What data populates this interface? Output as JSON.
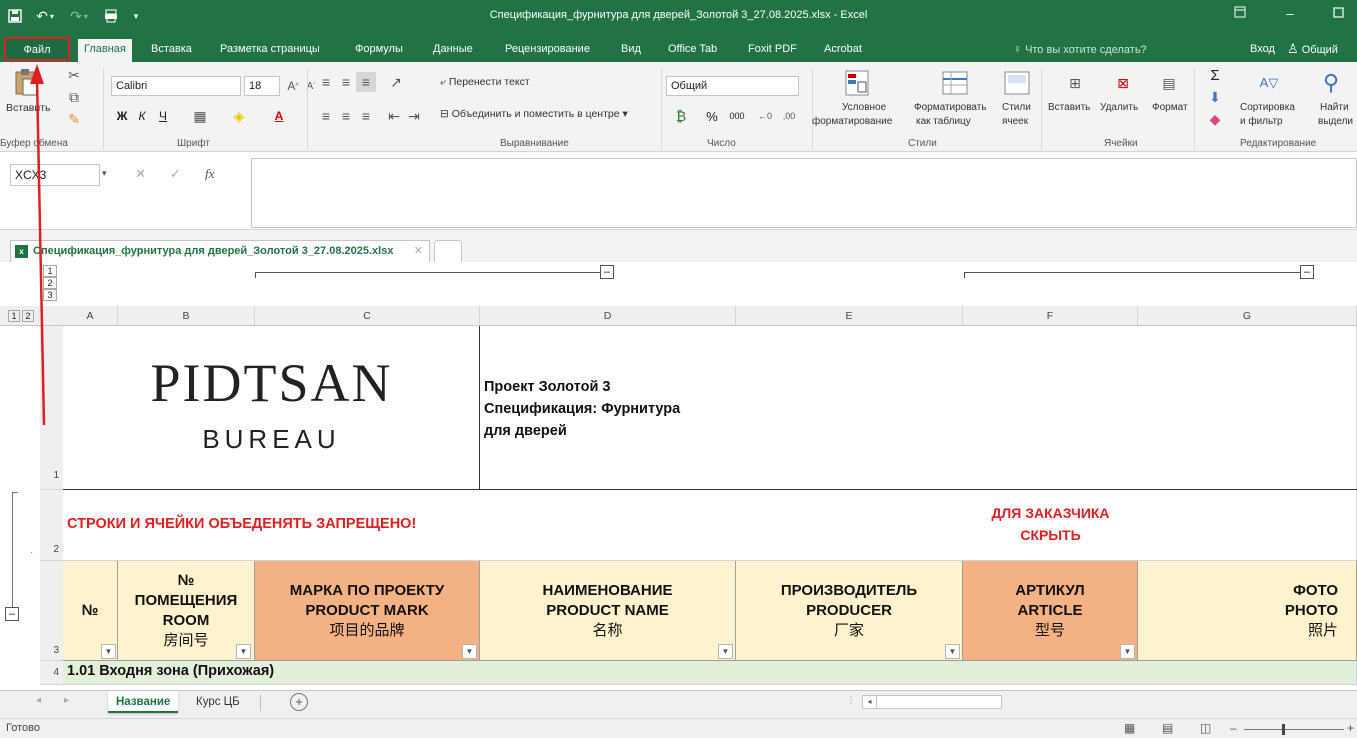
{
  "window": {
    "title": "Спецификация_фурнитура для дверей_Золотой 3_27.08.2025.xlsx  -  Excel"
  },
  "ribbon_tabs": {
    "file": "Файл",
    "items": [
      "Главная",
      "Вставка",
      "Разметка страницы",
      "Формулы",
      "Данные",
      "Рецензирование",
      "Вид",
      "Office Tab",
      "Foxit PDF",
      "Acrobat"
    ],
    "tell_me": "Что вы хотите сделать?",
    "sign_in": "Вход",
    "share": "Общий"
  },
  "ribbon": {
    "clipboard": {
      "paste": "Вставить",
      "group": "Буфер обмена"
    },
    "font": {
      "name": "Calibri",
      "size": "18",
      "group": "Шрифт"
    },
    "alignment": {
      "wrap": "Перенести текст",
      "merge": "Объединить и поместить в центре",
      "group": "Выравнивание"
    },
    "number": {
      "format": "Общий",
      "group": "Число"
    },
    "styles": {
      "cond1": "Условное",
      "cond2": "форматирование",
      "table1": "Форматировать",
      "table2": "как таблицу",
      "cell1": "Стили",
      "cell2": "ячеек",
      "group": "Стили"
    },
    "cells": {
      "insert": "Вставить",
      "delete": "Удалить",
      "format": "Формат",
      "group": "Ячейки"
    },
    "editing": {
      "sort1": "Сортировка",
      "sort2": "и фильтр",
      "find1": "Найти",
      "find2": "выдели",
      "group": "Редактирование"
    }
  },
  "formula_bar": {
    "name_box": "XCX3",
    "fx": "fx",
    "content": ""
  },
  "workbook_tab": {
    "name": "Спецификация_фурнитура для дверей_Золотой 3_27.08.2025.xlsx"
  },
  "grid": {
    "outline_levels_rows": [
      "1",
      "2",
      "3"
    ],
    "outline_levels_cols": [
      "1",
      "2"
    ],
    "column_headers": [
      "A",
      "B",
      "C",
      "D",
      "E",
      "F",
      "G"
    ],
    "row_headers": [
      "1",
      "2",
      "3",
      "4"
    ],
    "logo": {
      "main": "PIDTSAN",
      "sub": "BUREAU"
    },
    "project_lines": [
      "Проект Золотой 3",
      "Спецификация: Фурнитура",
      "для дверей"
    ],
    "warning": "СТРОКИ И ЯЧЕЙКИ ОБЪЕДЕНЯТЬ ЗАПРЕЩЕНО!",
    "customer_note": [
      "ДЛЯ ЗАКАЗЧИКА",
      "СКРЫТЬ"
    ],
    "headers": [
      {
        "lines": [
          "№"
        ],
        "cn": ""
      },
      {
        "lines": [
          "№",
          "ПОМЕЩЕНИЯ",
          "ROOM"
        ],
        "cn": "房间号"
      },
      {
        "lines": [
          "МАРКА ПО ПРОЕКТУ",
          "PRODUCT MARK"
        ],
        "cn": "项目的品牌"
      },
      {
        "lines": [
          "НАИМЕНОВАНИЕ",
          "PRODUCT NAME"
        ],
        "cn": "名称"
      },
      {
        "lines": [
          "ПРОИЗВОДИТЕЛЬ",
          "PRODUCER"
        ],
        "cn": "厂家"
      },
      {
        "lines": [
          "АРТИКУЛ",
          "ARTICLE"
        ],
        "cn": "型号"
      },
      {
        "lines": [
          "ФОТО",
          "PHOTO"
        ],
        "cn": "照片"
      }
    ],
    "section": "1.01 Входня зона (Прихожая)"
  },
  "sheets": [
    "Название",
    "Курс ЦБ"
  ],
  "status": {
    "ready": "Готово"
  },
  "colors": {
    "excel_green": "#217346",
    "header_yellow": "#fff2cc",
    "header_orange": "#f4b183",
    "section_green": "#e2efda",
    "warning_red": "#e02020"
  }
}
